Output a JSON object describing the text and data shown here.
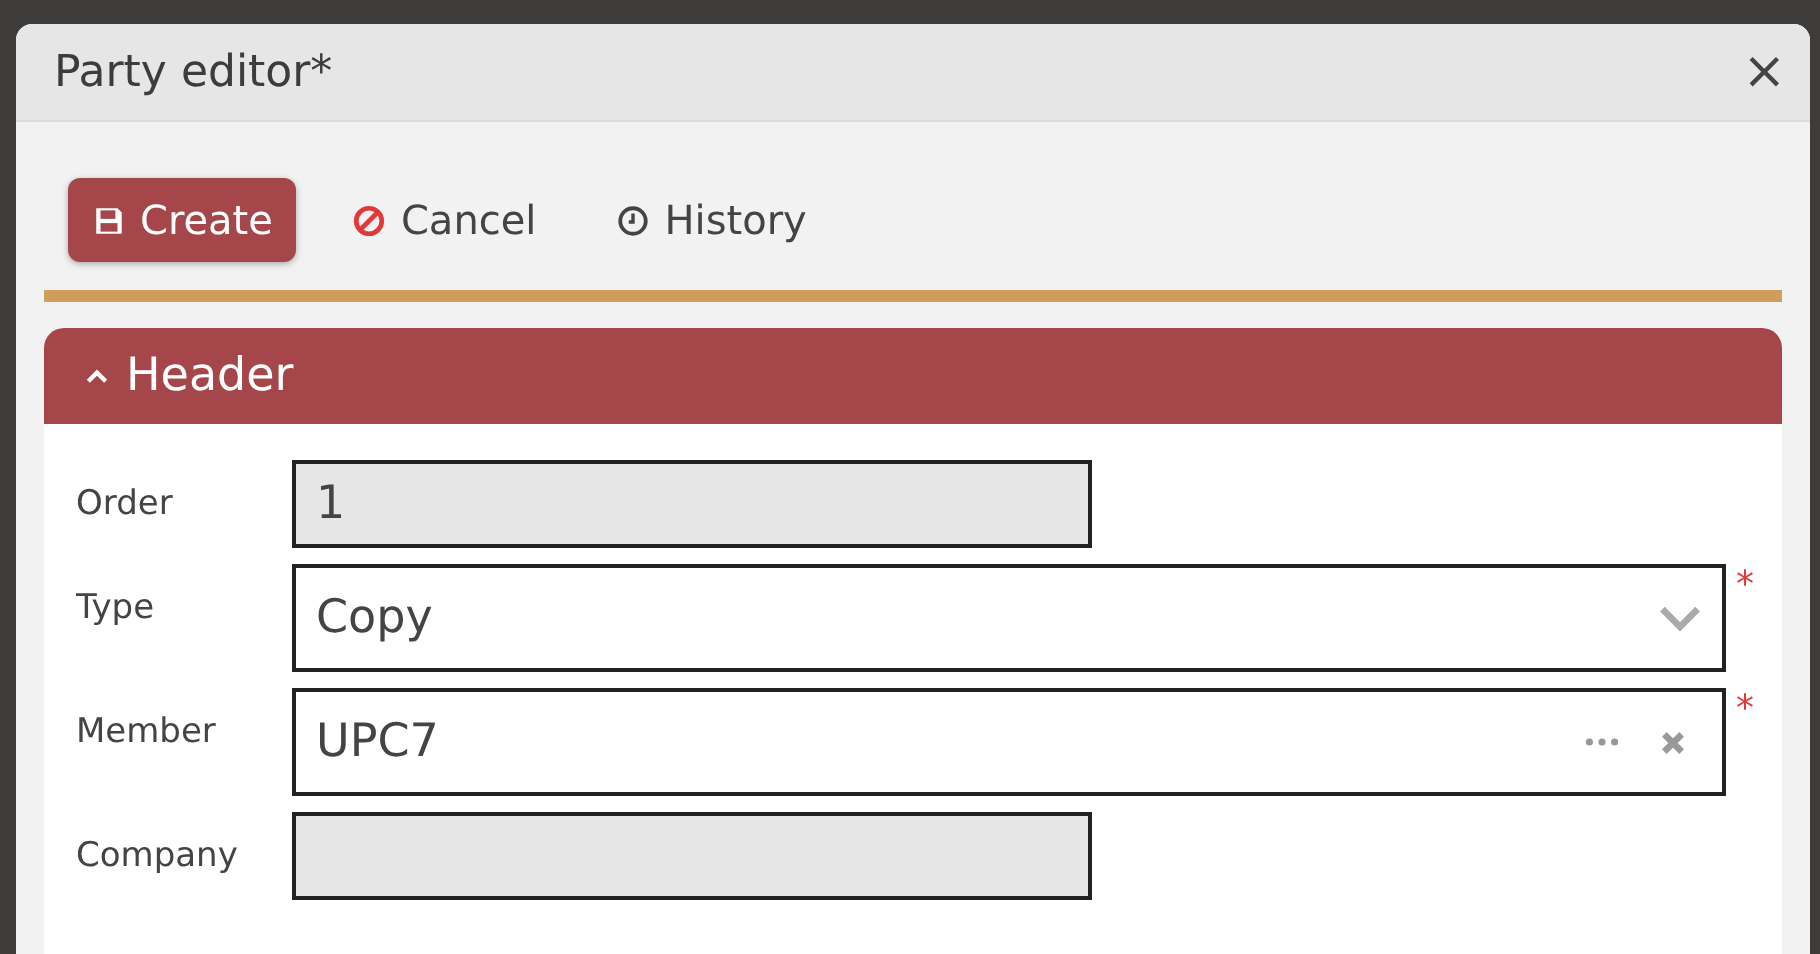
{
  "window": {
    "title": "Party editor*",
    "close": "×"
  },
  "toolbar": [
    {
      "kind": "primary",
      "label": "Create"
    },
    {
      "kind": "plain",
      "label": "Cancel"
    },
    {
      "kind": "plain",
      "label": "History"
    }
  ],
  "section": {
    "title": "Header",
    "expanded": true
  },
  "fields": [
    {
      "label": "Order",
      "kind": "readonly",
      "value": "1"
    },
    {
      "label": "Type",
      "kind": "select",
      "value": "Copy",
      "required_mark": "*"
    },
    {
      "label": "Member",
      "kind": "lookup",
      "value": "UPC7",
      "required_mark": "*"
    },
    {
      "label": "Company",
      "kind": "readonly"
    }
  ]
}
